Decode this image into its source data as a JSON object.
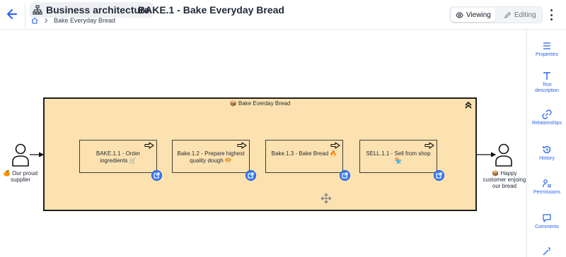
{
  "header": {
    "back_icon": "arrow-left-icon",
    "badge_icon": "org-chart-icon",
    "badge_label": "Business architecture",
    "title": "BAKE.1 - Bake Everyday Bread",
    "breadcrumb": {
      "home_icon": "home-icon",
      "separator_icon": "chevron-right-icon",
      "current": "Bake Everyday Bread"
    },
    "mode": {
      "viewing_label": "Viewing",
      "editing_label": "Editing",
      "active": "Viewing"
    },
    "more_icon": "more-vertical-icon"
  },
  "diagram": {
    "group": {
      "title": "📦 Bake Everday Bread",
      "fill": "#fce2b0",
      "collapse_icon": "chevrons-up-icon"
    },
    "processes": [
      {
        "label": "BAKE.1.1 - Order ingredients 🛒"
      },
      {
        "label": "Bake.1.2 - Prepare highest quality dough 🥯"
      },
      {
        "label": "Bake.1.3 - Bake Bread 🔥"
      },
      {
        "label": "SELL.1.1 - Sell from shop 🏪"
      }
    ],
    "actors": [
      {
        "label_line1": "🍊 Our proud",
        "label_line2": "supplier"
      },
      {
        "label_line1": "📦 Happy",
        "label_line2": "customer enjoing",
        "label_line3": "our bread"
      }
    ],
    "open_icon": "open-external-icon",
    "move_icon": "move-icon"
  },
  "right_panel": {
    "items": [
      {
        "icon": "list-icon",
        "label": "Properties"
      },
      {
        "icon": "text-icon",
        "label": "Text\ndescription"
      },
      {
        "icon": "link-icon",
        "label": "Relationships"
      },
      {
        "icon": "history-icon",
        "label": "History"
      },
      {
        "icon": "permissions-icon",
        "label": "Permissions"
      },
      {
        "icon": "comments-icon",
        "label": "Comments"
      },
      {
        "icon": "magic-wand-icon",
        "label": ""
      }
    ]
  },
  "colors": {
    "accent": "#2563eb",
    "group_fill": "#fce2b0",
    "open_button": "#3b82f6"
  }
}
